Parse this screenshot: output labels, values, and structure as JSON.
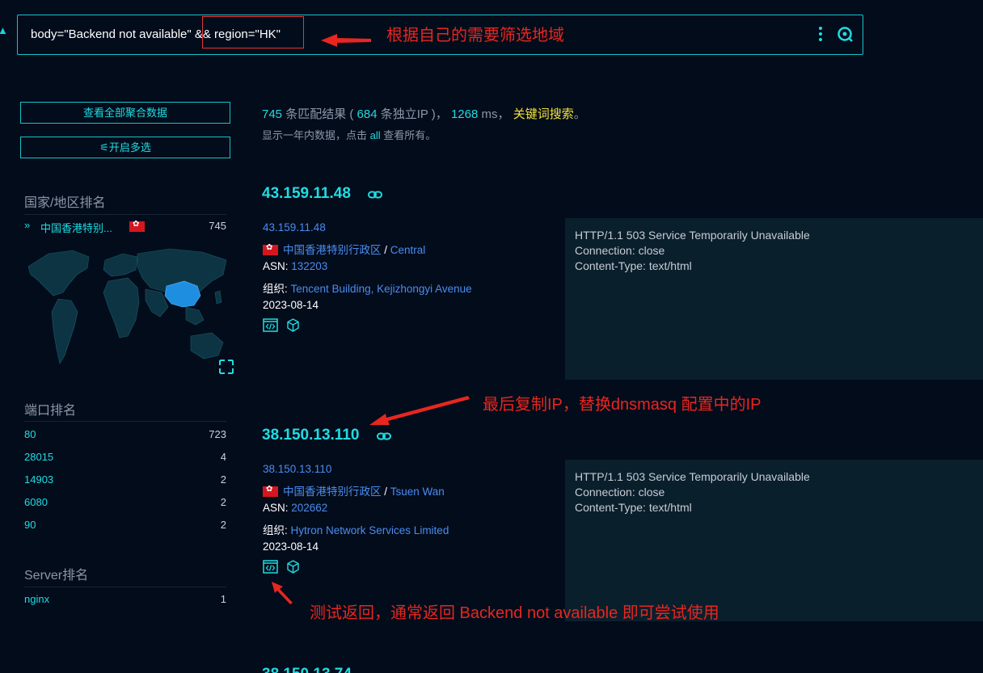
{
  "search": {
    "query": "body=\"Backend not available\" && region=\"HK\""
  },
  "annotations": {
    "filter_region": "根据自己的需要筛选地域",
    "copy_ip": "最后复制IP，替换dnsmasq 配置中的IP",
    "test_return": "测试返回，通常返回 Backend not available 即可尝试使用"
  },
  "sidebar": {
    "aggregate_button": "查看全部聚合数据",
    "multiselect_button": "⚟开启多选",
    "country_title": "国家/地区排名",
    "country_rows": [
      {
        "label": "中国香港特别...",
        "count": "745"
      }
    ],
    "port_title": "端口排名",
    "port_rows": [
      {
        "label": "80",
        "count": "723"
      },
      {
        "label": "28015",
        "count": "4"
      },
      {
        "label": "14903",
        "count": "2"
      },
      {
        "label": "6080",
        "count": "2"
      },
      {
        "label": "90",
        "count": "2"
      }
    ],
    "server_title": "Server排名",
    "server_rows": [
      {
        "label": "nginx",
        "count": "1"
      }
    ]
  },
  "summary": {
    "match_count": "745",
    "match_text": " 条匹配结果 ( ",
    "unique_ip": "684",
    "unique_text": " 条独立IP )， ",
    "ms": "1268",
    "ms_text": " ms， ",
    "keyword": "关键词搜索",
    "period": "。",
    "note_prefix": "显示一年内数据，点击 ",
    "note_all": "all",
    "note_suffix": " 查看所有。"
  },
  "results": [
    {
      "ip": "43.159.11.48",
      "ip_small": "43.159.11.48",
      "region": "中国香港特别行政区",
      "separator": " / ",
      "city": "Central",
      "asn_label": "ASN: ",
      "asn": "132203",
      "org_label": "组织: ",
      "org": "Tencent Building, Kejizhongyi Avenue",
      "date": "2023-08-14",
      "response": [
        "HTTP/1.1 503 Service Temporarily Unavailable",
        "Connection: close",
        "Content-Type: text/html"
      ]
    },
    {
      "ip": "38.150.13.110",
      "ip_small": "38.150.13.110",
      "region": "中国香港特别行政区",
      "separator": " / ",
      "city": "Tsuen Wan",
      "asn_label": "ASN: ",
      "asn": "202662",
      "org_label": "组织: ",
      "org": "Hytron Network Services Limited",
      "date": "2023-08-14",
      "response": [
        "HTTP/1.1 503 Service Temporarily Unavailable",
        "Connection: close",
        "Content-Type: text/html"
      ]
    },
    {
      "ip": "38.150.13.74"
    }
  ]
}
